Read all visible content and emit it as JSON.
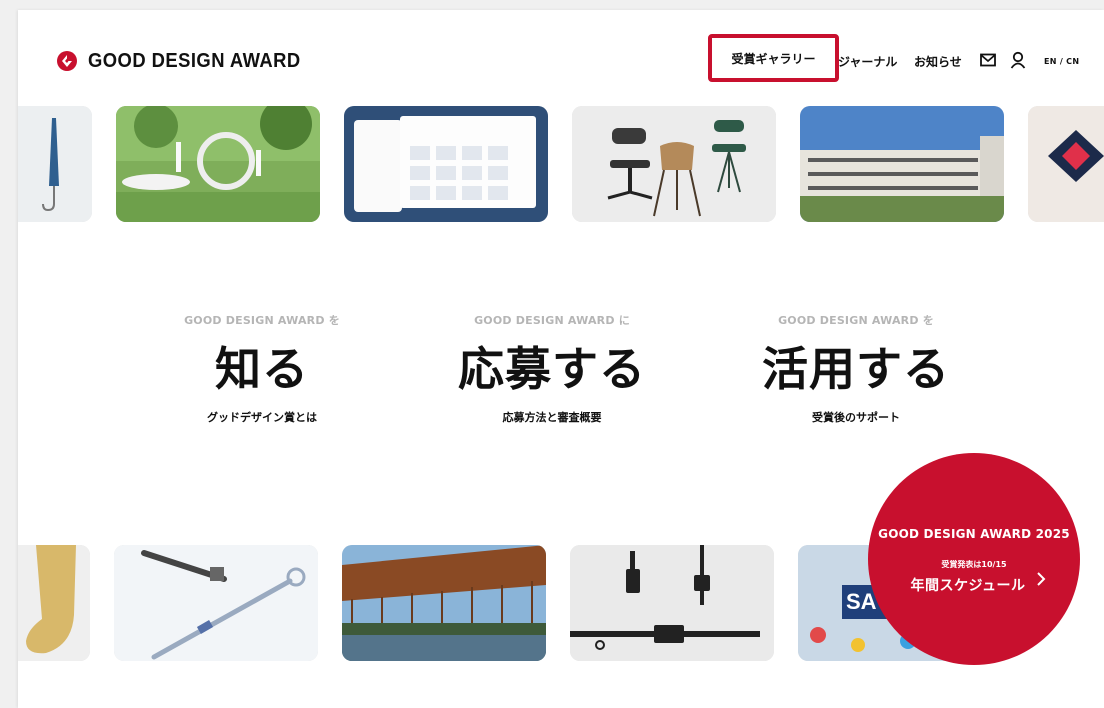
{
  "header": {
    "logo_text": "GOOD DESIGN AWARD",
    "nav": {
      "gallery": "受賞ギャラリー",
      "journal": "ジャーナル",
      "news": "お知らせ",
      "lang": "EN / CN"
    }
  },
  "columns": [
    {
      "sub": "GOOD DESIGN AWARD を",
      "big": "知る",
      "link": "グッドデザイン賞とは"
    },
    {
      "sub": "GOOD DESIGN AWARD に",
      "big": "応募する",
      "link": "応募方法と審査概要"
    },
    {
      "sub": "GOOD DESIGN AWARD を",
      "big": "活用する",
      "link": "受賞後のサポート"
    }
  ],
  "badge": {
    "title": "GOOD DESIGN AWARD 2025",
    "date": "受賞発表は10/15",
    "schedule": "年間スケジュール"
  },
  "tiles_bottom_text": "SA",
  "colors": {
    "brand_red": "#c8102e",
    "text": "#111111",
    "muted": "#b5b5b5"
  },
  "icons": [
    "g-mark-logo-icon",
    "mail-icon",
    "user-icon",
    "chevron-right-icon"
  ]
}
